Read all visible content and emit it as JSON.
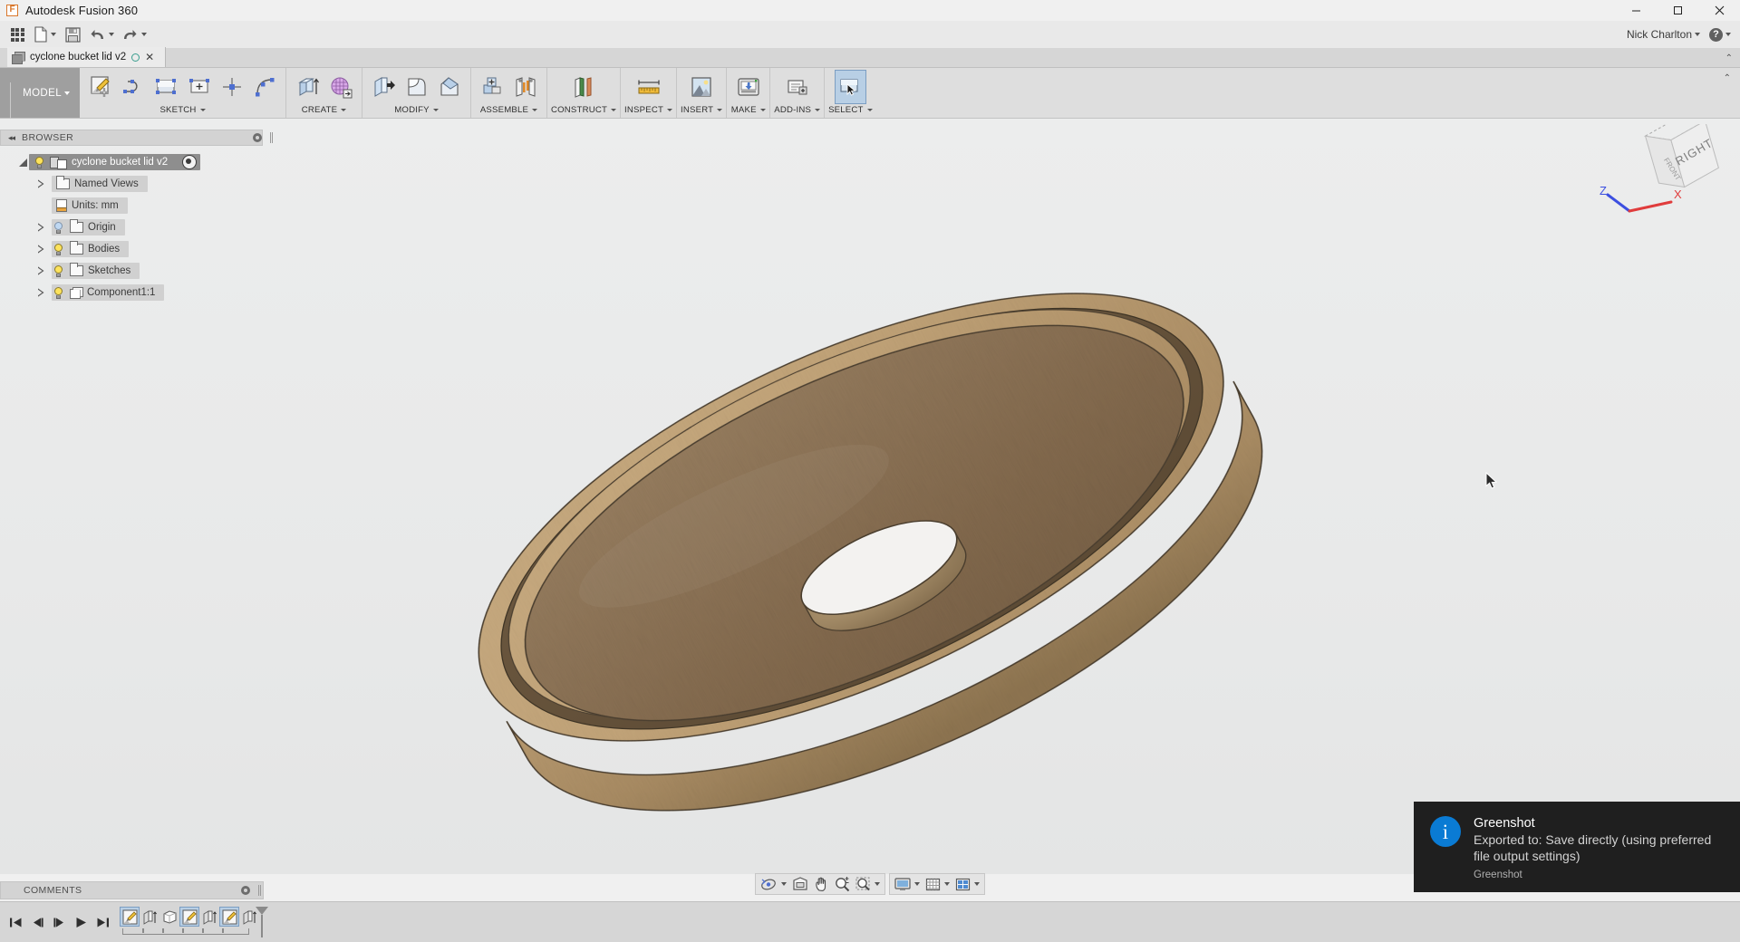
{
  "window": {
    "app_title": "Autodesk Fusion 360",
    "logo_glyph": "F",
    "minimize": "─",
    "maximize": "☐",
    "close": "✕"
  },
  "quick_access": {
    "items": [
      {
        "name": "app-grid",
        "icon": "grid-icon",
        "has_caret": false
      },
      {
        "name": "file",
        "icon": "file-icon",
        "has_caret": true
      },
      {
        "name": "save",
        "icon": "save-icon",
        "has_caret": false
      },
      {
        "name": "undo",
        "icon": "undo-icon",
        "has_caret": true
      },
      {
        "name": "redo",
        "icon": "redo-icon",
        "has_caret": true
      }
    ],
    "user_name": "Nick Charlton",
    "help_glyph": "?"
  },
  "document_tab": {
    "icon": "component-cube-icon",
    "label": "cyclone bucket lid v2",
    "unsaved_indicator": "unsaved-circle-icon",
    "close_glyph": "✕",
    "panel_chevron": "⌃"
  },
  "ribbon": {
    "workspace": {
      "label": "MODEL",
      "caret": "▾"
    },
    "collapse_chevron": "⌃",
    "groups": [
      {
        "label": "SKETCH",
        "buttons": [
          {
            "name": "create-sketch",
            "icon": "new-sketch-icon"
          },
          {
            "name": "sketch-line",
            "icon": "line-icon"
          },
          {
            "name": "sketch-rectangle",
            "icon": "rectangle-icon"
          },
          {
            "name": "sketch-create-dimension",
            "icon": "sketch-dimension-icon"
          },
          {
            "name": "sketch-point",
            "icon": "point-icon"
          },
          {
            "name": "sketch-arc",
            "icon": "arc-icon"
          }
        ]
      },
      {
        "label": "CREATE",
        "buttons": [
          {
            "name": "extrude",
            "icon": "extrude-icon"
          },
          {
            "name": "create-form",
            "icon": "form-icon"
          }
        ]
      },
      {
        "label": "MODIFY",
        "buttons": [
          {
            "name": "press-pull",
            "icon": "press-pull-icon"
          },
          {
            "name": "fillet",
            "icon": "fillet-icon"
          },
          {
            "name": "chamfer",
            "icon": "chamfer-icon"
          }
        ]
      },
      {
        "label": "ASSEMBLE",
        "buttons": [
          {
            "name": "new-component",
            "icon": "new-component-icon"
          },
          {
            "name": "joint",
            "icon": "joint-icon"
          }
        ]
      },
      {
        "label": "CONSTRUCT",
        "buttons": [
          {
            "name": "offset-plane",
            "icon": "offset-plane-icon"
          }
        ]
      },
      {
        "label": "INSPECT",
        "buttons": [
          {
            "name": "measure",
            "icon": "measure-ruler-icon"
          }
        ]
      },
      {
        "label": "INSERT",
        "buttons": [
          {
            "name": "insert-canvas",
            "icon": "picture-icon"
          }
        ]
      },
      {
        "label": "MAKE",
        "buttons": [
          {
            "name": "3d-print",
            "icon": "3d-print-icon"
          }
        ]
      },
      {
        "label": "ADD-INS",
        "buttons": [
          {
            "name": "scripts-and-addins",
            "icon": "addins-icon"
          }
        ]
      },
      {
        "label": "SELECT",
        "buttons": [
          {
            "name": "select-tool",
            "icon": "select-arrow-icon",
            "active": true
          }
        ]
      }
    ]
  },
  "browser": {
    "title": "BROWSER",
    "collapse_glyph": "◂◂",
    "tree": [
      {
        "name": "root-document",
        "label": "cyclone bucket lid v2",
        "indent": 0,
        "expander": "down",
        "bulb": "on",
        "icon": "assembly-icon",
        "root": true,
        "has_display_toggle": true
      },
      {
        "name": "named-views",
        "label": "Named Views",
        "indent": 1,
        "expander": "right",
        "bulb": "none",
        "icon": "folder-icon"
      },
      {
        "name": "units",
        "label": "Units: mm",
        "indent": 1,
        "expander": "none",
        "bulb": "none",
        "icon": "document-icon"
      },
      {
        "name": "origin",
        "label": "Origin",
        "indent": 1,
        "expander": "right",
        "bulb": "off",
        "icon": "folder-icon"
      },
      {
        "name": "bodies",
        "label": "Bodies",
        "indent": 1,
        "expander": "right",
        "bulb": "on",
        "icon": "folder-icon"
      },
      {
        "name": "sketches",
        "label": "Sketches",
        "indent": 1,
        "expander": "right",
        "bulb": "on",
        "icon": "folder-icon"
      },
      {
        "name": "component1",
        "label": "Component1:1",
        "indent": 1,
        "expander": "right",
        "bulb": "on",
        "icon": "component-icon"
      }
    ]
  },
  "comments": {
    "title": "COMMENTS"
  },
  "viewcube": {
    "face_label": "RIGHT",
    "front_label": "FRONT",
    "axis_x": "X",
    "axis_z": "Z",
    "axis_x_color": "#e03c3c",
    "axis_z_color": "#3c4fe0"
  },
  "navbar": {
    "groups": [
      {
        "buttons": [
          {
            "name": "orbit",
            "icon": "orbit-icon",
            "caret": true
          },
          {
            "name": "look-at",
            "icon": "look-at-icon",
            "caret": false
          },
          {
            "name": "pan",
            "icon": "pan-hand-icon",
            "caret": false
          },
          {
            "name": "zoom",
            "icon": "zoom-magnifier-icon",
            "caret": false
          },
          {
            "name": "zoom-window",
            "icon": "zoom-window-icon",
            "caret": true
          }
        ]
      },
      {
        "buttons": [
          {
            "name": "display-settings",
            "icon": "monitor-icon",
            "caret": true
          },
          {
            "name": "grid-and-snaps",
            "icon": "grid-settings-icon",
            "caret": true
          },
          {
            "name": "viewports",
            "icon": "viewports-icon",
            "caret": true
          }
        ]
      }
    ]
  },
  "timeline": {
    "playback": [
      {
        "name": "timeline-go-to-beginning",
        "icon": "skip-back-icon"
      },
      {
        "name": "timeline-step-back",
        "icon": "step-back-icon"
      },
      {
        "name": "timeline-step-forward",
        "icon": "step-forward-icon"
      },
      {
        "name": "timeline-play",
        "icon": "play-icon"
      },
      {
        "name": "timeline-go-to-end",
        "icon": "skip-end-icon"
      }
    ],
    "features": [
      {
        "name": "timeline-feature-sketch-1",
        "icon": "sketch-feature-icon",
        "selected": true
      },
      {
        "name": "timeline-feature-extrude-1",
        "icon": "extrude-feature-icon",
        "selected": false
      },
      {
        "name": "timeline-feature-body-1",
        "icon": "body-feature-icon",
        "selected": false
      },
      {
        "name": "timeline-feature-sketch-2",
        "icon": "sketch-feature-icon",
        "selected": true
      },
      {
        "name": "timeline-feature-extrude-2",
        "icon": "extrude-feature-icon",
        "selected": false
      },
      {
        "name": "timeline-feature-sketch-3",
        "icon": "sketch-feature-icon",
        "selected": true
      },
      {
        "name": "timeline-feature-extrude-3",
        "icon": "extrude-feature-icon",
        "selected": false
      }
    ]
  },
  "toast": {
    "icon_glyph": "i",
    "title": "Greenshot",
    "message": "Exported to: Save directly (using preferred file output settings)",
    "app_name": "Greenshot",
    "accent_color": "#0a7bd4",
    "background_color": "#1f1f1f"
  },
  "model": {
    "description": "3D shaded MDF disc with stepped rim and centre hole, isometric view",
    "material_color": "#8a7253",
    "edge_color": "#4a3e2e",
    "rim_color": "#c6a97e"
  }
}
